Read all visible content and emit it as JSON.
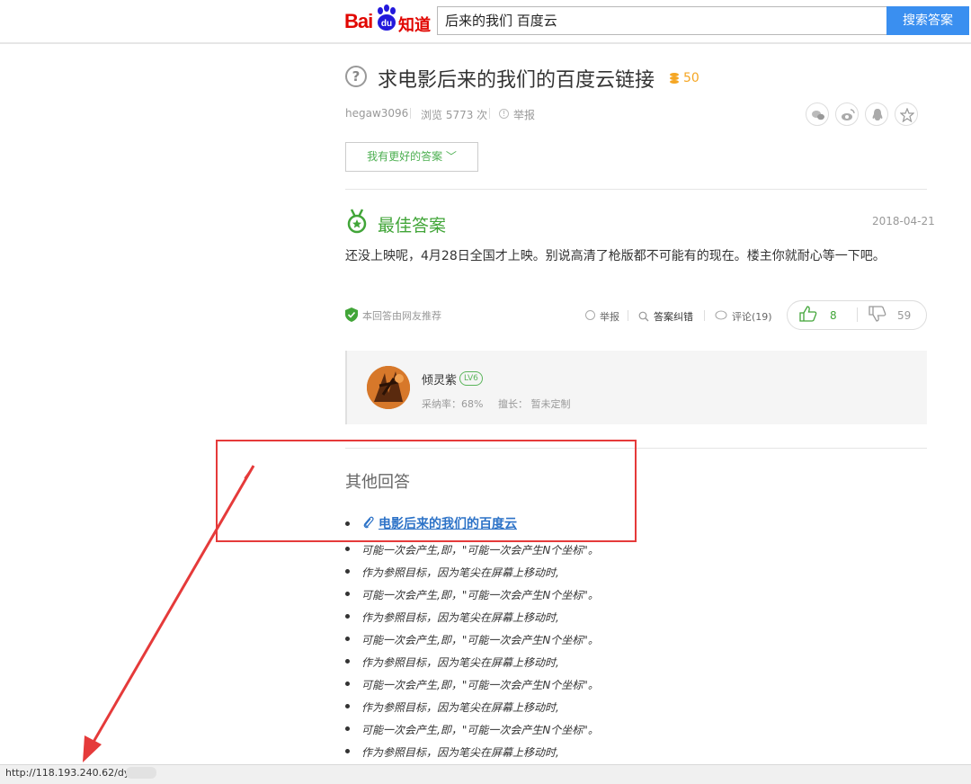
{
  "header": {
    "logo_bai": "Bai",
    "logo_du": "du",
    "logo_zhidao": "知道",
    "search_value": "后来的我们 百度云",
    "search_button": "搜索答案"
  },
  "question": {
    "title": "求电影后来的我们的百度云链接",
    "reward": "50",
    "author": "hegaw3096",
    "views": "浏览 5773 次",
    "report": "举报",
    "better_answer_btn": "我有更好的答案 ﹀"
  },
  "best_answer": {
    "label": "最佳答案",
    "date": "2018-04-21",
    "text": "还没上映呢，4月28日全国才上映。别说高清了枪版都不可能有的现在。楼主你就耐心等一下吧。",
    "recommended": "本回答由网友推荐",
    "report": "举报",
    "correct": "答案纠错",
    "comment": "评论(19)",
    "upvotes": "8",
    "downvotes": "59"
  },
  "user": {
    "name": "倾灵紫",
    "level": "LV6",
    "adoption_rate": "采纳率：68%",
    "expertise": "擅长： 暂未定制"
  },
  "other_answers": {
    "title": "其他回答",
    "link_text": "电影后来的我们的百度云",
    "lines": [
      "可能一次会产生,即，\"可能一次会产生N个坐标\"。",
      "作为参照目标，因为笔尖在屏幕上移动时,",
      "可能一次会产生,即，\"可能一次会产生N个坐标\"。",
      "作为参照目标，因为笔尖在屏幕上移动时,",
      "可能一次会产生,即，\"可能一次会产生N个坐标\"。",
      "作为参照目标，因为笔尖在屏幕上移动时,",
      "可能一次会产生,即，\"可能一次会产生N个坐标\"。",
      "作为参照目标，因为笔尖在屏幕上移动时,",
      "可能一次会产生,即，\"可能一次会产生N个坐标\"。",
      "作为参照目标，因为笔尖在屏幕上移动时,"
    ]
  },
  "status_bar": {
    "url": "http://118.193.240.62/dy"
  },
  "colors": {
    "brand_red": "#e10601",
    "search_blue": "#3a8ff0",
    "green": "#41a538",
    "link_blue": "#2c72c7",
    "annotation_red": "#e53a3a",
    "reward_gold": "#f5a623"
  },
  "icons": [
    "paw-icon",
    "question-icon",
    "coin-icon",
    "report-icon",
    "wechat-icon",
    "weibo-icon",
    "qq-icon",
    "star-icon",
    "medal-icon",
    "shield-check-icon",
    "search-icon",
    "comment-icon",
    "thumbs-up-icon",
    "thumbs-down-icon",
    "paperclip-icon"
  ]
}
